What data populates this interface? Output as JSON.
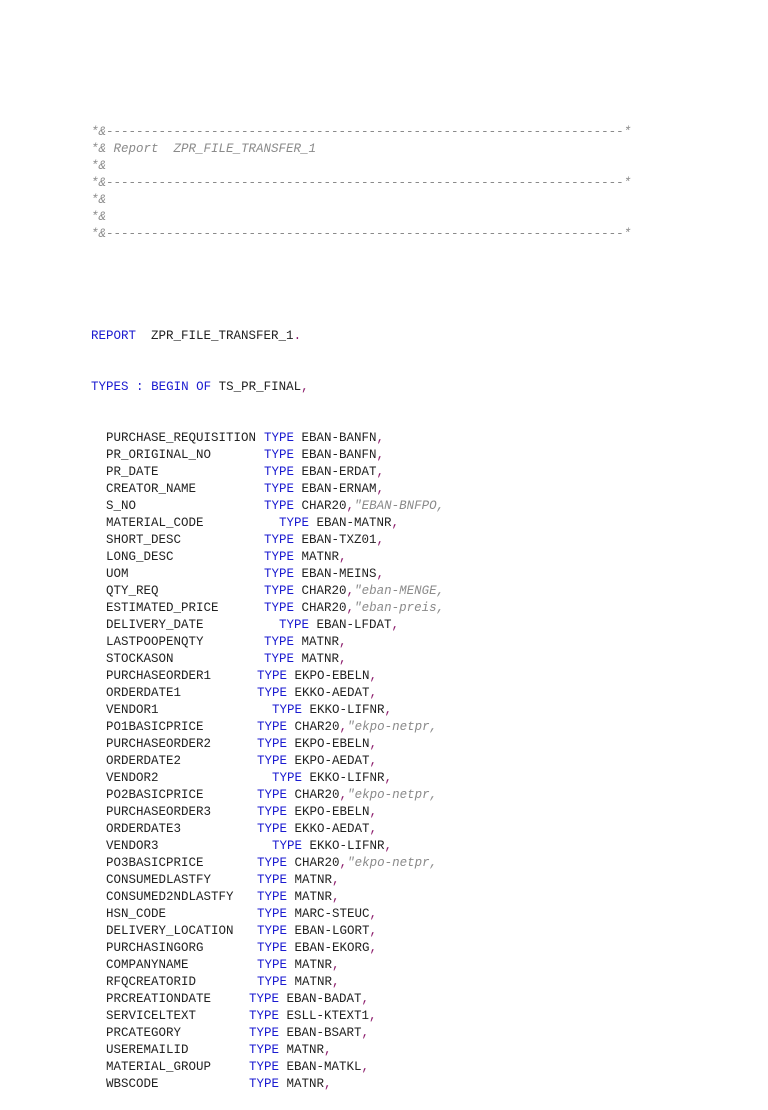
{
  "header_comments": [
    "*&---------------------------------------------------------------------*",
    "*& Report  ZPR_FILE_TRANSFER_1",
    "*&",
    "*&---------------------------------------------------------------------*",
    "*&",
    "*&",
    "*&---------------------------------------------------------------------*"
  ],
  "report_stmt": {
    "keyword": "REPORT",
    "name": "ZPR_FILE_TRANSFER_1",
    "end": "."
  },
  "types_stmt": {
    "kw1": "TYPES",
    "colon": ":",
    "kw2": "BEGIN OF",
    "name": "TS_PR_FINAL",
    "end": ","
  },
  "type_keyword": "TYPE",
  "fields": [
    {
      "name": "PURCHASE_REQUISITION",
      "type": "EBAN-BANFN"
    },
    {
      "name": "PR_ORIGINAL_NO",
      "type": "EBAN-BANFN"
    },
    {
      "name": "PR_DATE",
      "type": "EBAN-ERDAT"
    },
    {
      "name": "CREATOR_NAME",
      "type": "EBAN-ERNAM"
    },
    {
      "name": "S_NO",
      "type": "CHAR20",
      "comment": "\"EBAN-BNFPO,"
    },
    {
      "name": "MATERIAL_CODE",
      "type": "EBAN-MATNR"
    },
    {
      "name": "SHORT_DESC",
      "type": "EBAN-TXZ01"
    },
    {
      "name": "LONG_DESC",
      "type": "MATNR"
    },
    {
      "name": "UOM",
      "type": "EBAN-MEINS"
    },
    {
      "name": "QTY_REQ",
      "type": "CHAR20",
      "comment": "\"eban-MENGE,"
    },
    {
      "name": "ESTIMATED_PRICE",
      "type": "CHAR20",
      "comment": "\"eban-preis,"
    },
    {
      "name": "DELIVERY_DATE",
      "type": "EBAN-LFDAT"
    },
    {
      "name": "LASTPOOPENQTY",
      "type": "MATNR"
    },
    {
      "name": "STOCKASON",
      "type": "MATNR"
    },
    {
      "name": "PURCHASEORDER1",
      "type": "EKPO-EBELN"
    },
    {
      "name": "ORDERDATE1",
      "type": "EKKO-AEDAT"
    },
    {
      "name": "VENDOR1",
      "type": "EKKO-LIFNR"
    },
    {
      "name": "PO1BASICPRICE",
      "type": "CHAR20",
      "comment": "\"ekpo-netpr,"
    },
    {
      "name": "PURCHASEORDER2",
      "type": "EKPO-EBELN"
    },
    {
      "name": "ORDERDATE2",
      "type": "EKPO-AEDAT"
    },
    {
      "name": "VENDOR2",
      "type": "EKKO-LIFNR"
    },
    {
      "name": "PO2BASICPRICE",
      "type": "CHAR20",
      "comment": "\"ekpo-netpr,"
    },
    {
      "name": "PURCHASEORDER3",
      "type": "EKPO-EBELN"
    },
    {
      "name": "ORDERDATE3",
      "type": "EKKO-AEDAT"
    },
    {
      "name": "VENDOR3",
      "type": "EKKO-LIFNR"
    },
    {
      "name": "PO3BASICPRICE",
      "type": "CHAR20",
      "comment": "\"ekpo-netpr,"
    },
    {
      "name": "CONSUMEDLASTFY",
      "type": "MATNR"
    },
    {
      "name": "CONSUMED2NDLASTFY",
      "type": "MATNR"
    },
    {
      "name": "HSN_CODE",
      "type": "MARC-STEUC"
    },
    {
      "name": "DELIVERY_LOCATION",
      "type": "EBAN-LGORT"
    },
    {
      "name": "PURCHASINGORG",
      "type": "EBAN-EKORG"
    },
    {
      "name": "COMPANYNAME",
      "type": "MATNR"
    },
    {
      "name": "RFQCREATORID",
      "type": "MATNR"
    },
    {
      "name": "PRCREATIONDATE",
      "type": "EBAN-BADAT"
    },
    {
      "name": "SERVICELTEXT",
      "type": "ESLL-KTEXT1"
    },
    {
      "name": "PRCATEGORY",
      "type": "EBAN-BSART"
    },
    {
      "name": "USEREMAILID",
      "type": "MATNR"
    },
    {
      "name": "MATERIAL_GROUP",
      "type": "EBAN-MATKL"
    },
    {
      "name": "WBSCODE",
      "type": "MATNR"
    }
  ]
}
